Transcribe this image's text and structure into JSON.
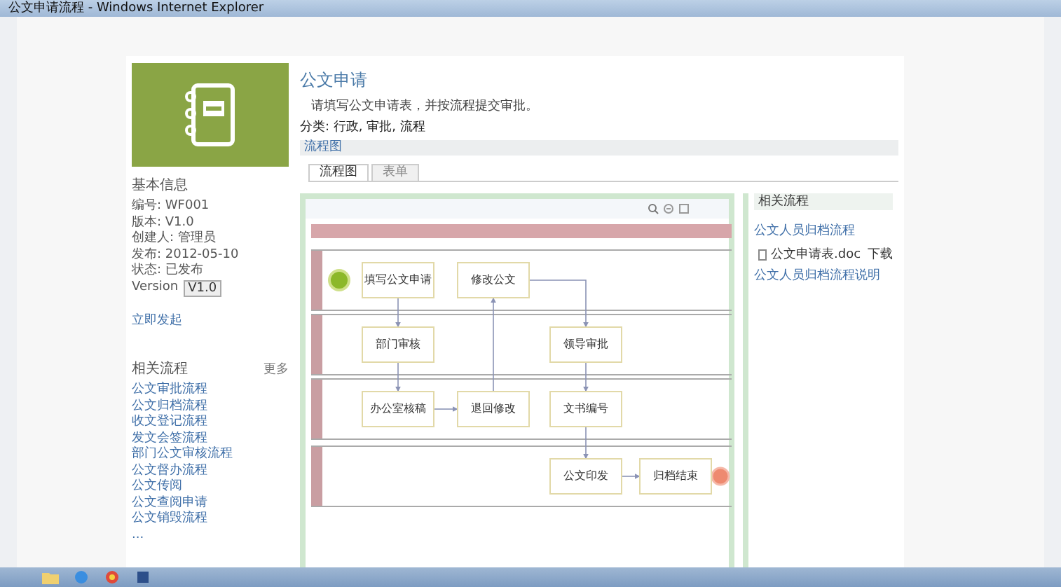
{
  "window": {
    "title": "公文申请流程 - Windows Internet Explorer"
  },
  "sidebar": {
    "info_title": "基本信息",
    "info": [
      "编号: WF001",
      "版本: V1.0",
      "创建人: 管理员",
      "发布: 2012-05-10",
      "状态: 已发布"
    ],
    "version_label": "Version",
    "version_value": "V1.0",
    "action_link": "立即发起",
    "related_title": "相关流程",
    "more": "更多",
    "related": [
      "公文审批流程",
      "公文归档流程",
      "收文登记流程",
      "发文会签流程",
      "部门公文审核流程",
      "公文督办流程",
      "公文传阅",
      "公文查阅申请",
      "公文销毁流程",
      "..."
    ]
  },
  "header": {
    "title": "公文申请",
    "description": "请填写公文申请表，并按流程提交审批。",
    "meta": "分类: 行政, 审批, 流程"
  },
  "section_bar": "流程图",
  "tabs": [
    {
      "label": "流程图",
      "selected": true
    },
    {
      "label": "表单",
      "selected": false
    }
  ],
  "diagram": {
    "nodes": [
      "填写公文申请",
      "修改公文",
      "部门审核",
      "领导审批",
      "办公室核稿",
      "退回修改",
      "文书编号",
      "公文印发",
      "归档结束"
    ]
  },
  "side_panel": {
    "title": "相关流程",
    "items": [
      {
        "kind": "link",
        "text": "公文人员归档流程"
      },
      {
        "kind": "file",
        "text": "公文申请表.doc",
        "action": "下载"
      },
      {
        "kind": "link",
        "text": "公文人员归档流程说明"
      }
    ]
  }
}
